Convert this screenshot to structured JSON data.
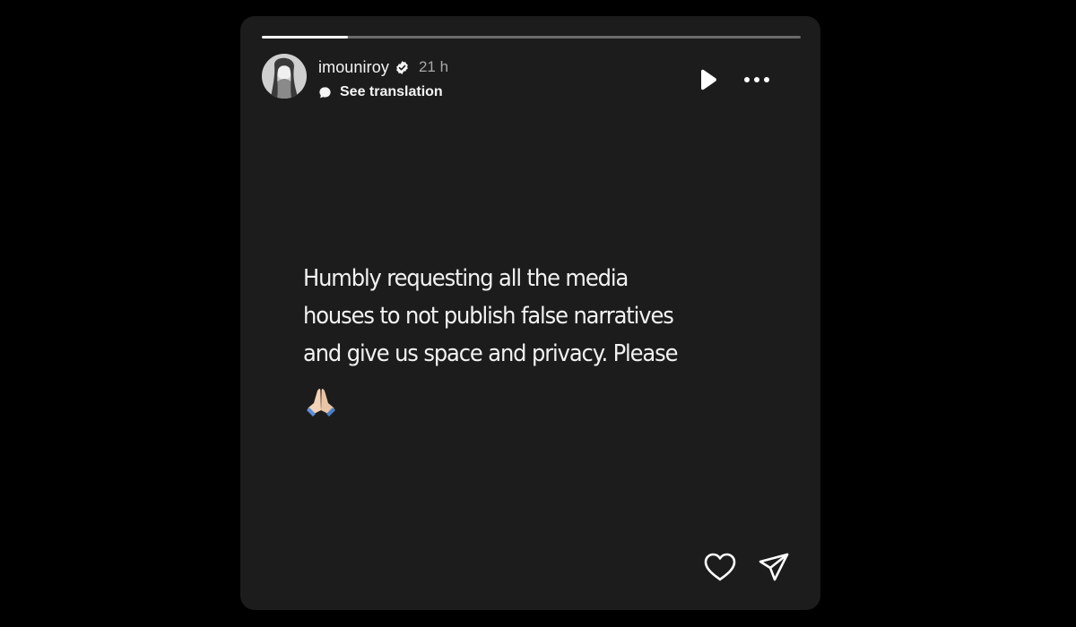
{
  "story": {
    "progress": 0.16,
    "author": {
      "username": "imouniroy",
      "verified": true,
      "avatar_icon": "profile-photo"
    },
    "timestamp": "21 h",
    "translation": {
      "label": "See translation",
      "icon": "translate-bubble-icon"
    },
    "controls": {
      "play_icon": "play-icon",
      "more_icon": "more-dots-icon"
    },
    "message": "Humbly requesting all the media\nhouses to not publish false narratives\nand give us space and privacy. Please",
    "emoji": "🙏",
    "actions": {
      "like_icon": "heart-icon",
      "share_icon": "send-icon"
    }
  }
}
